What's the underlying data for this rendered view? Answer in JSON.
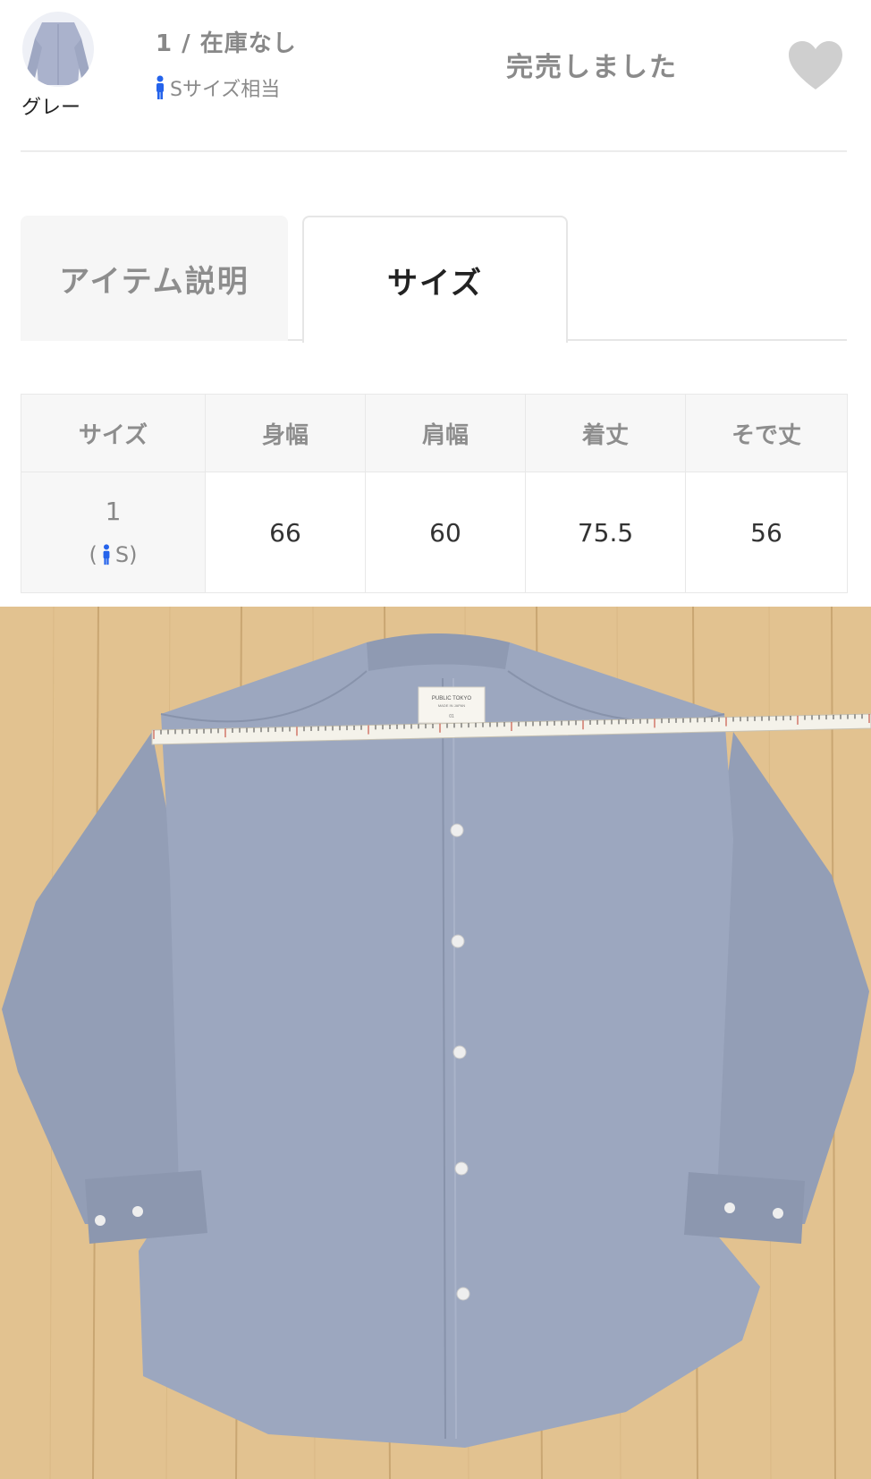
{
  "sku": {
    "color_name": "グレー",
    "stock_text": "1 / 在庫なし",
    "fit_text": "Sサイズ相当",
    "soldout_text": "完売しました"
  },
  "tabs": [
    {
      "label": "アイテム説明",
      "active": false
    },
    {
      "label": "サイズ",
      "active": true
    }
  ],
  "size_table": {
    "headers": [
      "サイズ",
      "身幅",
      "肩幅",
      "着丈",
      "そで丈"
    ],
    "rows": [
      {
        "size": "1",
        "fit_open": "(",
        "fit_label": "S)",
        "values": [
          "66",
          "60",
          "75.5",
          "56"
        ]
      }
    ]
  },
  "photo": {
    "label_brand": "PUBLIC TOKYO",
    "label_sub": "MADE IN JAPAN",
    "label_size": "01"
  },
  "colors": {
    "accent_blue": "#2563eb",
    "soldout_gray": "#8a8a8a",
    "heart_gray": "#cfcfcf",
    "shirt": "#9aa5bd",
    "floor": "#e2c290"
  }
}
